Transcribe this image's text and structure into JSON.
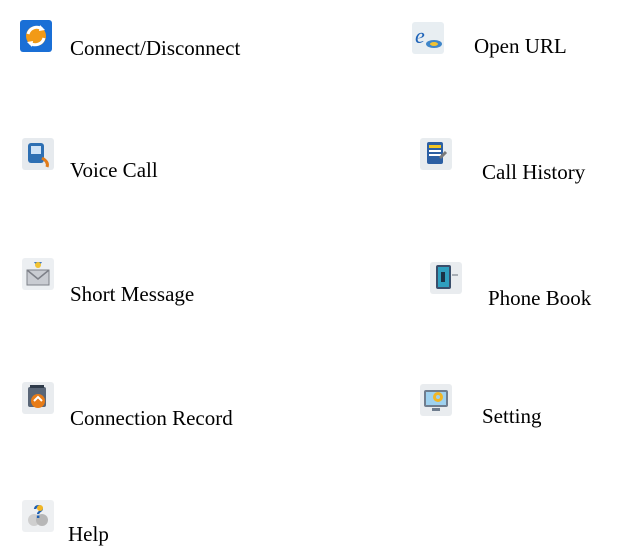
{
  "menu": {
    "items": [
      {
        "id": "connect",
        "label": "Connect/Disconnect",
        "icon": "connect-disconnect-icon"
      },
      {
        "id": "open-url",
        "label": "Open URL",
        "icon": "browser-icon"
      },
      {
        "id": "voice-call",
        "label": "Voice Call",
        "icon": "phone-call-icon"
      },
      {
        "id": "call-history",
        "label": "Call History",
        "icon": "call-history-icon"
      },
      {
        "id": "short-message",
        "label": "Short Message",
        "icon": "envelope-icon"
      },
      {
        "id": "phone-book",
        "label": "Phone Book",
        "icon": "address-book-icon"
      },
      {
        "id": "connection-record",
        "label": "Connection Record",
        "icon": "connection-record-icon"
      },
      {
        "id": "setting",
        "label": "Setting",
        "icon": "settings-monitor-icon"
      },
      {
        "id": "help",
        "label": "Help",
        "icon": "help-icon"
      }
    ]
  }
}
